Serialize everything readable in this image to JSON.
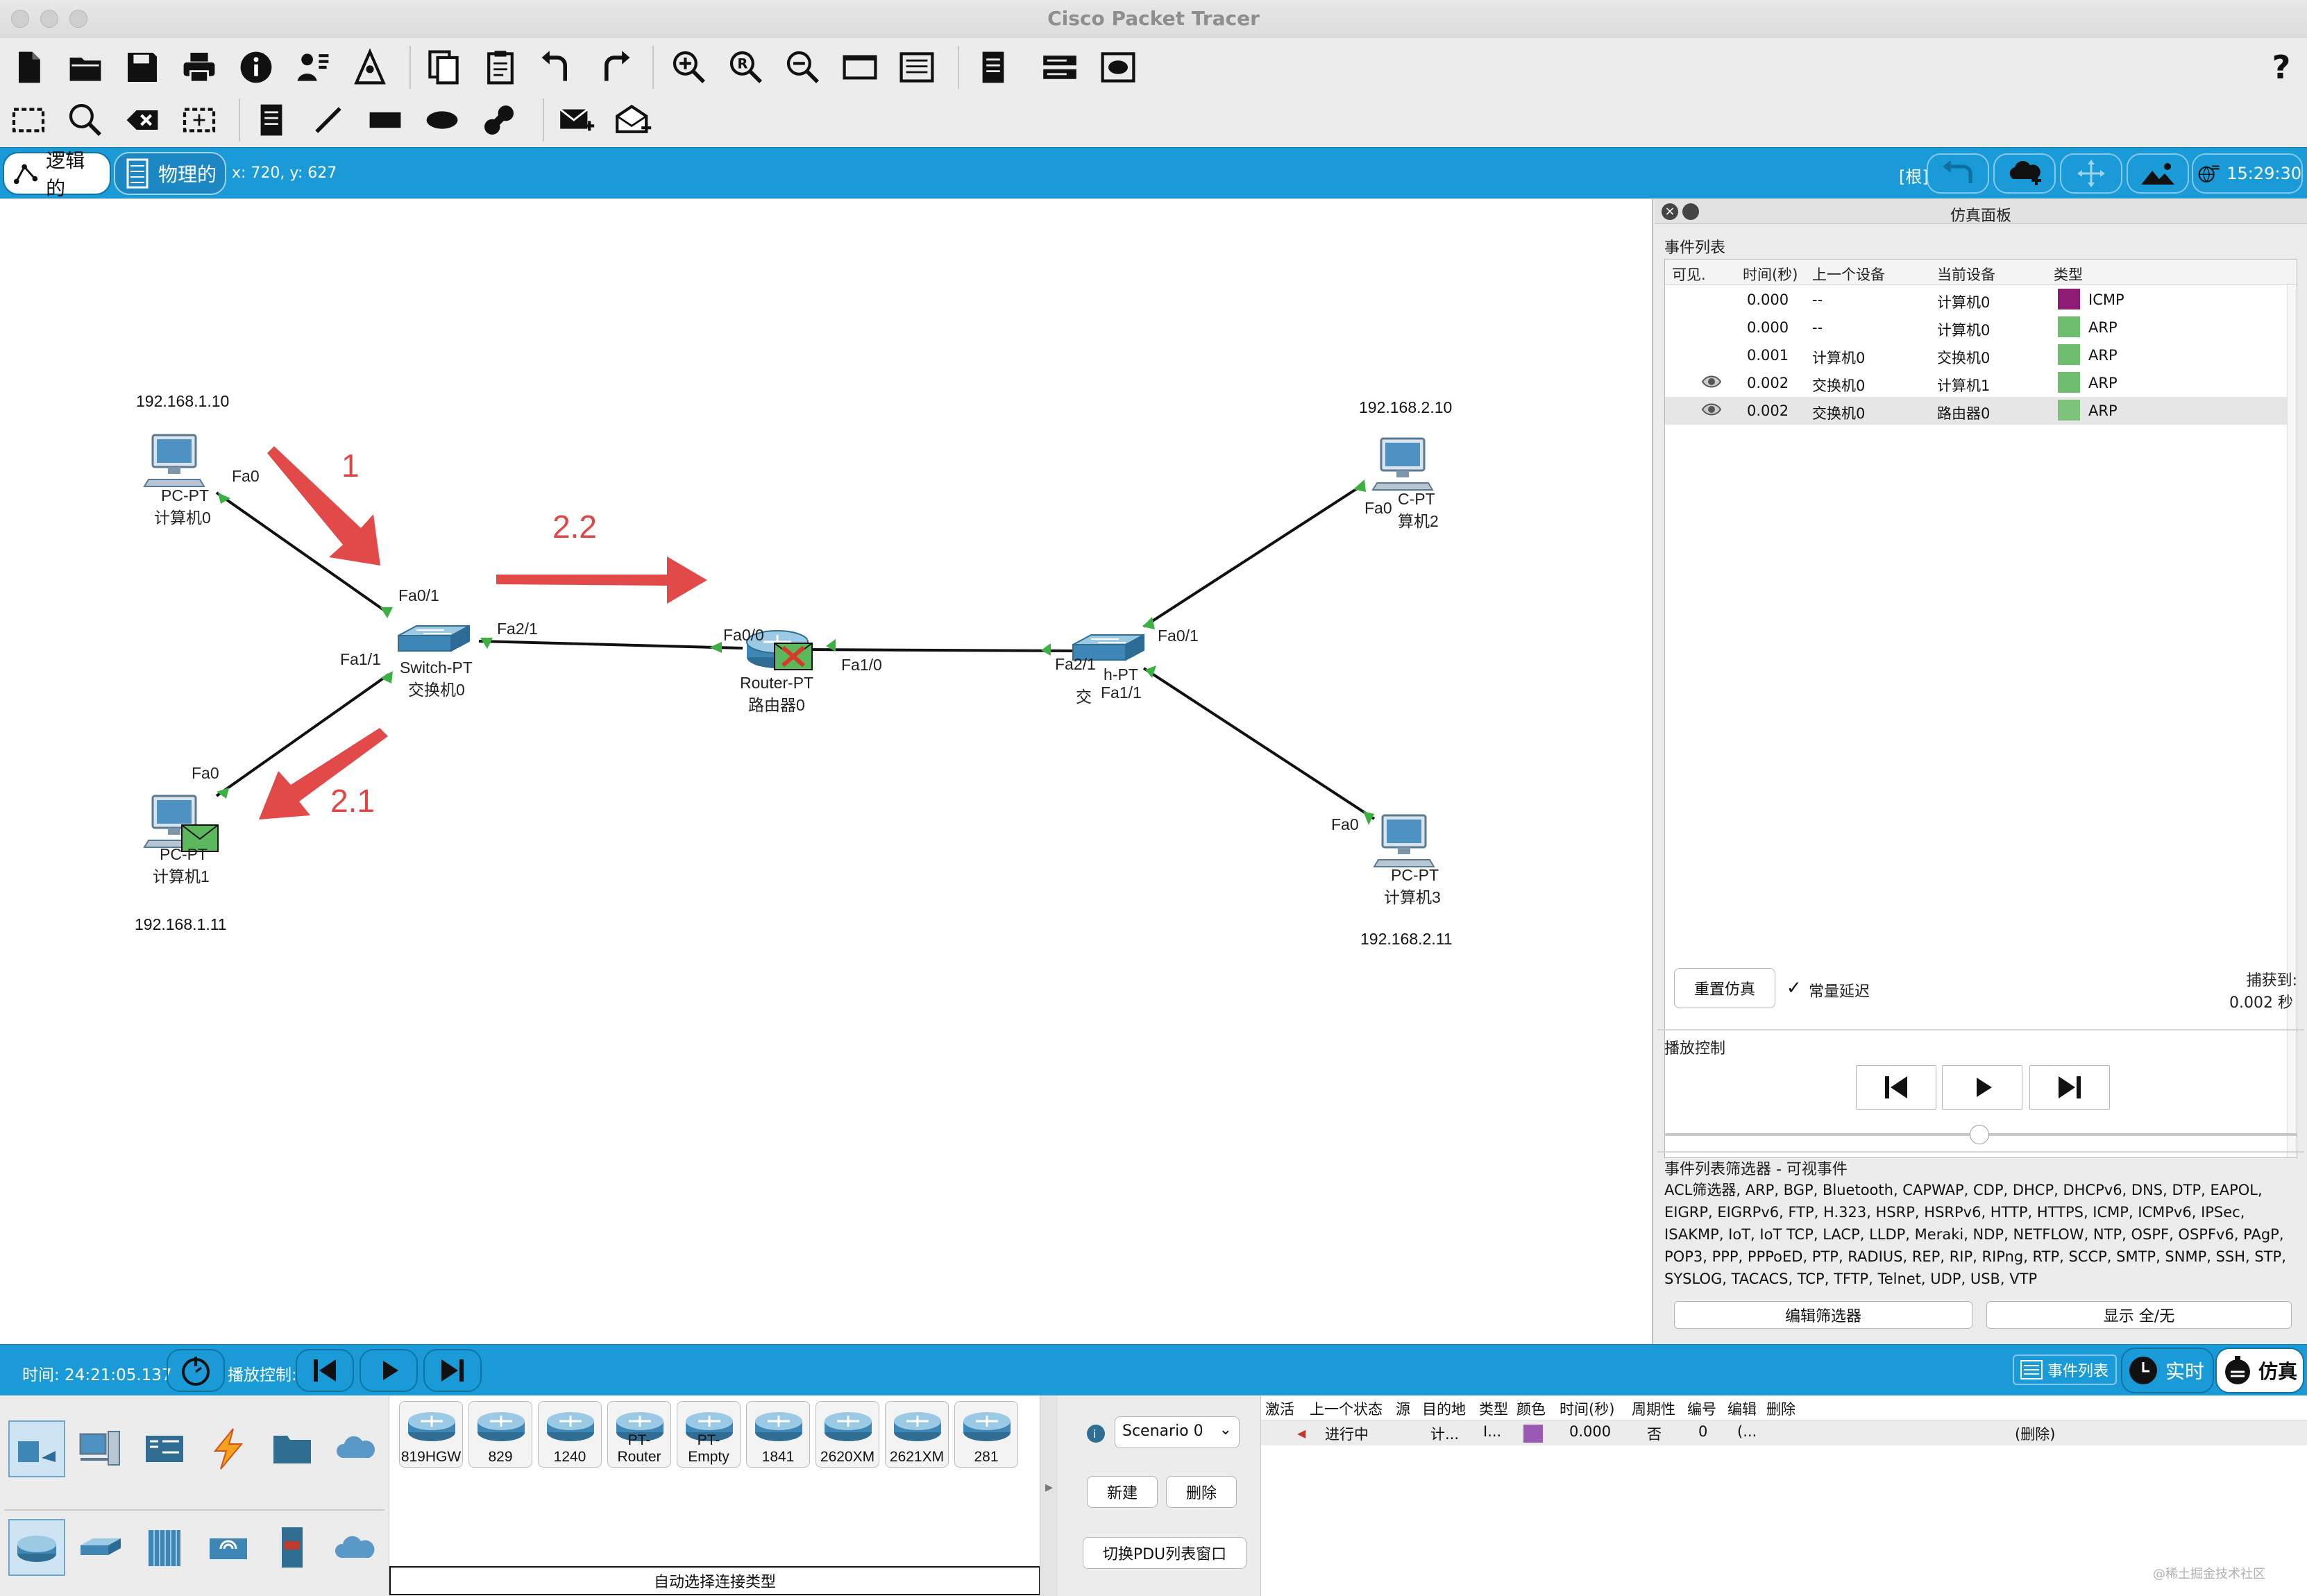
{
  "window": {
    "title": "Cisco Packet Tracer"
  },
  "toolbar1": {
    "icons": [
      "new-file-icon",
      "open-folder-icon",
      "save-icon",
      "print-icon",
      "info-icon",
      "activity-wizard-icon",
      "network-info-icon",
      "copy-icon",
      "paste-icon",
      "undo-icon",
      "redo-icon",
      "zoom-in-icon",
      "zoom-reset-icon",
      "zoom-out-icon",
      "drawing-palette-icon",
      "custom-device-icon",
      "notes-icon",
      "device-dialog-icon",
      "viewport-icon"
    ],
    "help": "?"
  },
  "workspace_bar": {
    "logical_tab": "逻辑的",
    "physical_tab": "物理的",
    "coords": "x: 720, y: 627",
    "root": "[根]",
    "clock": "15:29:30"
  },
  "topology": {
    "nodes": {
      "pc0": {
        "model": "PC-PT",
        "name": "计算机0",
        "ip": "192.168.1.10",
        "port": "Fa0"
      },
      "pc1": {
        "model": "PC-PT",
        "name": "计算机1",
        "ip": "192.168.1.11",
        "port": "Fa0"
      },
      "pc2": {
        "model": "C-PT",
        "name": "算机2",
        "ip": "192.168.2.10",
        "port": "Fa0"
      },
      "pc3": {
        "model": "PC-PT",
        "name": "计算机3",
        "ip": "192.168.2.11",
        "port": "Fa0"
      },
      "sw0": {
        "model": "Switch-PT",
        "name": "交换机0",
        "ports": [
          "Fa0/1",
          "Fa1/1",
          "Fa2/1"
        ]
      },
      "router0": {
        "model": "Router-PT",
        "name": "路由器0",
        "ports": [
          "Fa0/0",
          "Fa1/0"
        ]
      },
      "sw1": {
        "model": "h-PT",
        "name": "交",
        "ports": [
          "Fa0/1",
          "Fa1/1",
          "Fa2/1"
        ]
      }
    },
    "annotations": [
      "1",
      "2.2",
      "2.1"
    ]
  },
  "sim_panel": {
    "title": "仿真面板",
    "event_list_label": "事件列表",
    "columns": [
      "可见.",
      "时间(秒)",
      "上一个设备",
      "当前设备",
      "类型"
    ],
    "events": [
      {
        "visible": "",
        "time": "0.000",
        "last": "--",
        "current": "计算机0",
        "type": "ICMP",
        "color": "#8e1b74"
      },
      {
        "visible": "",
        "time": "0.000",
        "last": "--",
        "current": "计算机0",
        "type": "ARP",
        "color": "#6ebd6e"
      },
      {
        "visible": "",
        "time": "0.001",
        "last": "计算机0",
        "current": "交换机0",
        "type": "ARP",
        "color": "#6ebd6e"
      },
      {
        "visible": "eye",
        "time": "0.002",
        "last": "交换机0",
        "current": "计算机1",
        "type": "ARP",
        "color": "#6ebd6e"
      },
      {
        "visible": "eye",
        "time": "0.002",
        "last": "交换机0",
        "current": "路由器0",
        "type": "ARP",
        "color": "#7cc37c"
      }
    ],
    "reset_btn": "重置仿真",
    "constant_delay": "常量延迟",
    "captured_label": "捕获到:",
    "captured_value": "0.002 秒",
    "playback_label": "播放控制",
    "filter_title": "事件列表筛选器 - 可视事件",
    "filter_text": "ACL筛选器, ARP, BGP, Bluetooth, CAPWAP, CDP, DHCP, DHCPv6, DNS, DTP, EAPOL, EIGRP, EIGRPv6, FTP, H.323, HSRP, HSRPv6, HTTP, HTTPS, ICMP, ICMPv6, IPSec, ISAKMP, IoT, IoT TCP, LACP, LLDP, Meraki, NDP, NETFLOW, NTP, OSPF, OSPFv6, PAgP, POP3, PPP, PPPoED, PTP, RADIUS, REP, RIP, RIPng, RTP, SCCP, SMTP, SNMP, SSH, STP, SYSLOG, TACACS, TCP, TFTP, Telnet, UDP, USB, VTP",
    "edit_filter_btn": "编辑筛选器",
    "show_all_btn": "显示 全/无"
  },
  "bottom_bar": {
    "time_label": "时间: 24:21:05.137",
    "playback_label": "播放控制:",
    "event_list_btn": "事件列表",
    "realtime_btn": "实时",
    "simulation_btn": "仿真"
  },
  "device_panel": {
    "models": [
      "819HGW",
      "829",
      "1240",
      "PT-Router",
      "PT-Empty",
      "1841",
      "2620XM",
      "2621XM",
      "281"
    ],
    "connection_type": "自动选择连接类型"
  },
  "scenario": {
    "selected": "Scenario 0",
    "new_btn": "新建",
    "delete_btn": "删除",
    "toggle_pdu_btn": "切换PDU列表窗口"
  },
  "pdu_table": {
    "headers": [
      "激活",
      "上一个状态",
      "源",
      "目的地",
      "类型",
      "颜色",
      "时间(秒)",
      "周期性",
      "编号",
      "编辑",
      "删除"
    ],
    "row": {
      "status": "进行中",
      "source": "计...",
      "dest": "I...",
      "time": "0.000",
      "periodic": "否",
      "num": "0",
      "edit": "(...",
      "delete": "(删除)",
      "color": "#9b59b6"
    }
  },
  "watermark": "@稀土掘金技术社区"
}
